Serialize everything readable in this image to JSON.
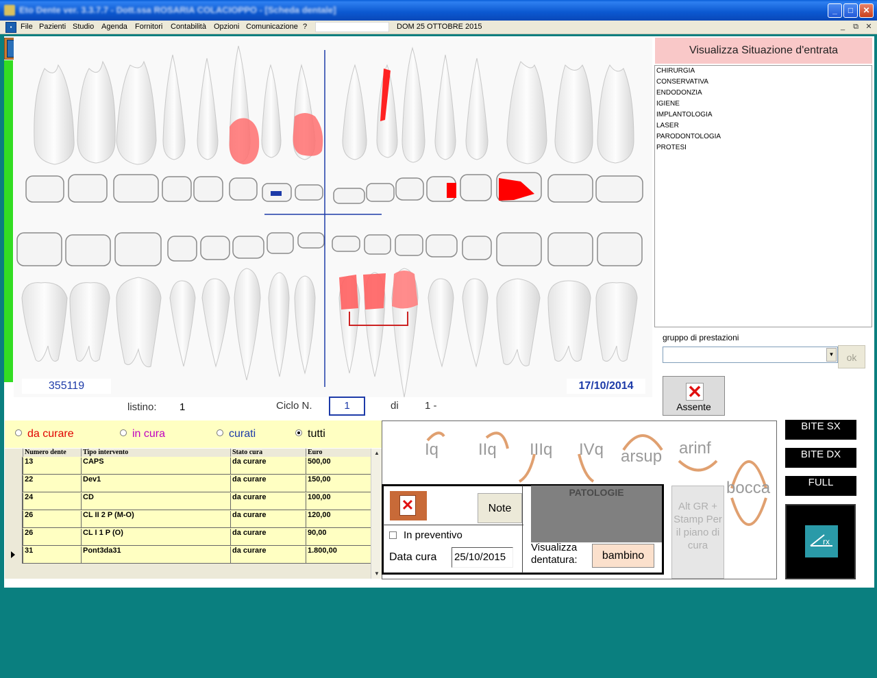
{
  "window": {
    "title": "Eto Dente ver. 3.3.7.7 - Dott.ssa ROSARIA COLACIOPPO - [Scheda dentale]",
    "buttons": {
      "minimize": "_",
      "maximize": "□",
      "close": "✕"
    }
  },
  "menubar": {
    "items": [
      "File",
      "Pazienti",
      "Studio",
      "Agenda",
      "Fornitori",
      "Contabilità",
      "Opzioni",
      "Comunicazione",
      "?"
    ],
    "date": "DOM 25 OTTOBRE 2015",
    "mdi": {
      "minimize": "_",
      "restore": "⧉",
      "close": "✕"
    }
  },
  "chart": {
    "patient_id": "355119",
    "date": "17/10/2014"
  },
  "right_panel": {
    "visualizza_label": "Visualizza Situazione d'entrata",
    "categories": [
      "CHIRURGIA",
      "CONSERVATIVA",
      "ENDODONZIA",
      "IGIENE",
      "IMPLANTOLOGIA",
      "LASER",
      "PARODONTOLOGIA",
      "PROTESI"
    ],
    "group_label": "gruppo di prestazioni",
    "group_value": "",
    "ok_label": "ok",
    "absent_label": "Assente"
  },
  "cycle": {
    "listino_label": "listino:",
    "listino_value": "1",
    "ciclo_label": "Ciclo N.",
    "ciclo_value": "1",
    "di_label": "di",
    "di_value": "1 -"
  },
  "filters": [
    {
      "label": "da curare",
      "color": "#e00000",
      "checked": false
    },
    {
      "label": "in cura",
      "color": "#c000c0",
      "checked": false
    },
    {
      "label": "curati",
      "color": "#1c3aa8",
      "checked": false
    },
    {
      "label": "tutti",
      "color": "#000000",
      "checked": true
    }
  ],
  "table": {
    "columns": [
      "Numero dente",
      "Tipo intervento",
      "Stato cura",
      "Euro"
    ],
    "rows": [
      [
        "13",
        "CAPS",
        "da curare",
        "500,00"
      ],
      [
        "22",
        "Dev1",
        "da curare",
        "150,00"
      ],
      [
        "24",
        "CD",
        "da curare",
        "100,00"
      ],
      [
        "26",
        "CL II 2 P (M-O)",
        "da curare",
        "120,00"
      ],
      [
        "26",
        "CL I 1 P (O)",
        "da curare",
        "90,00"
      ],
      [
        "31",
        "Pont3da31",
        "da curare",
        "1.800,00"
      ]
    ],
    "current_row": 5
  },
  "quadrants": [
    "Iq",
    "IIq",
    "IIIq",
    "IVq",
    "arsup",
    "arinf",
    "bocca"
  ],
  "treatment": {
    "note_label": "Note",
    "preventivo_label": "In preventivo",
    "preventivo_checked": false,
    "data_cura_label": "Data cura",
    "data_cura_value": "25/10/2015",
    "patologie_label": "PATOLOGIE",
    "visualizza_dentatura_label": "Visualizza dentatura:",
    "bambino_label": "bambino"
  },
  "altgr_label": "Alt GR + Stamp Per il piano di cura",
  "bite": {
    "sx": "BITE SX",
    "dx": "BITE DX",
    "full": "FULL",
    "rx_label": "rx"
  },
  "colors": {
    "accent_green": "#33dd22",
    "background": "#0a7f7f",
    "treatment_red": "#e00000",
    "table_yellow": "#ffffc2"
  }
}
